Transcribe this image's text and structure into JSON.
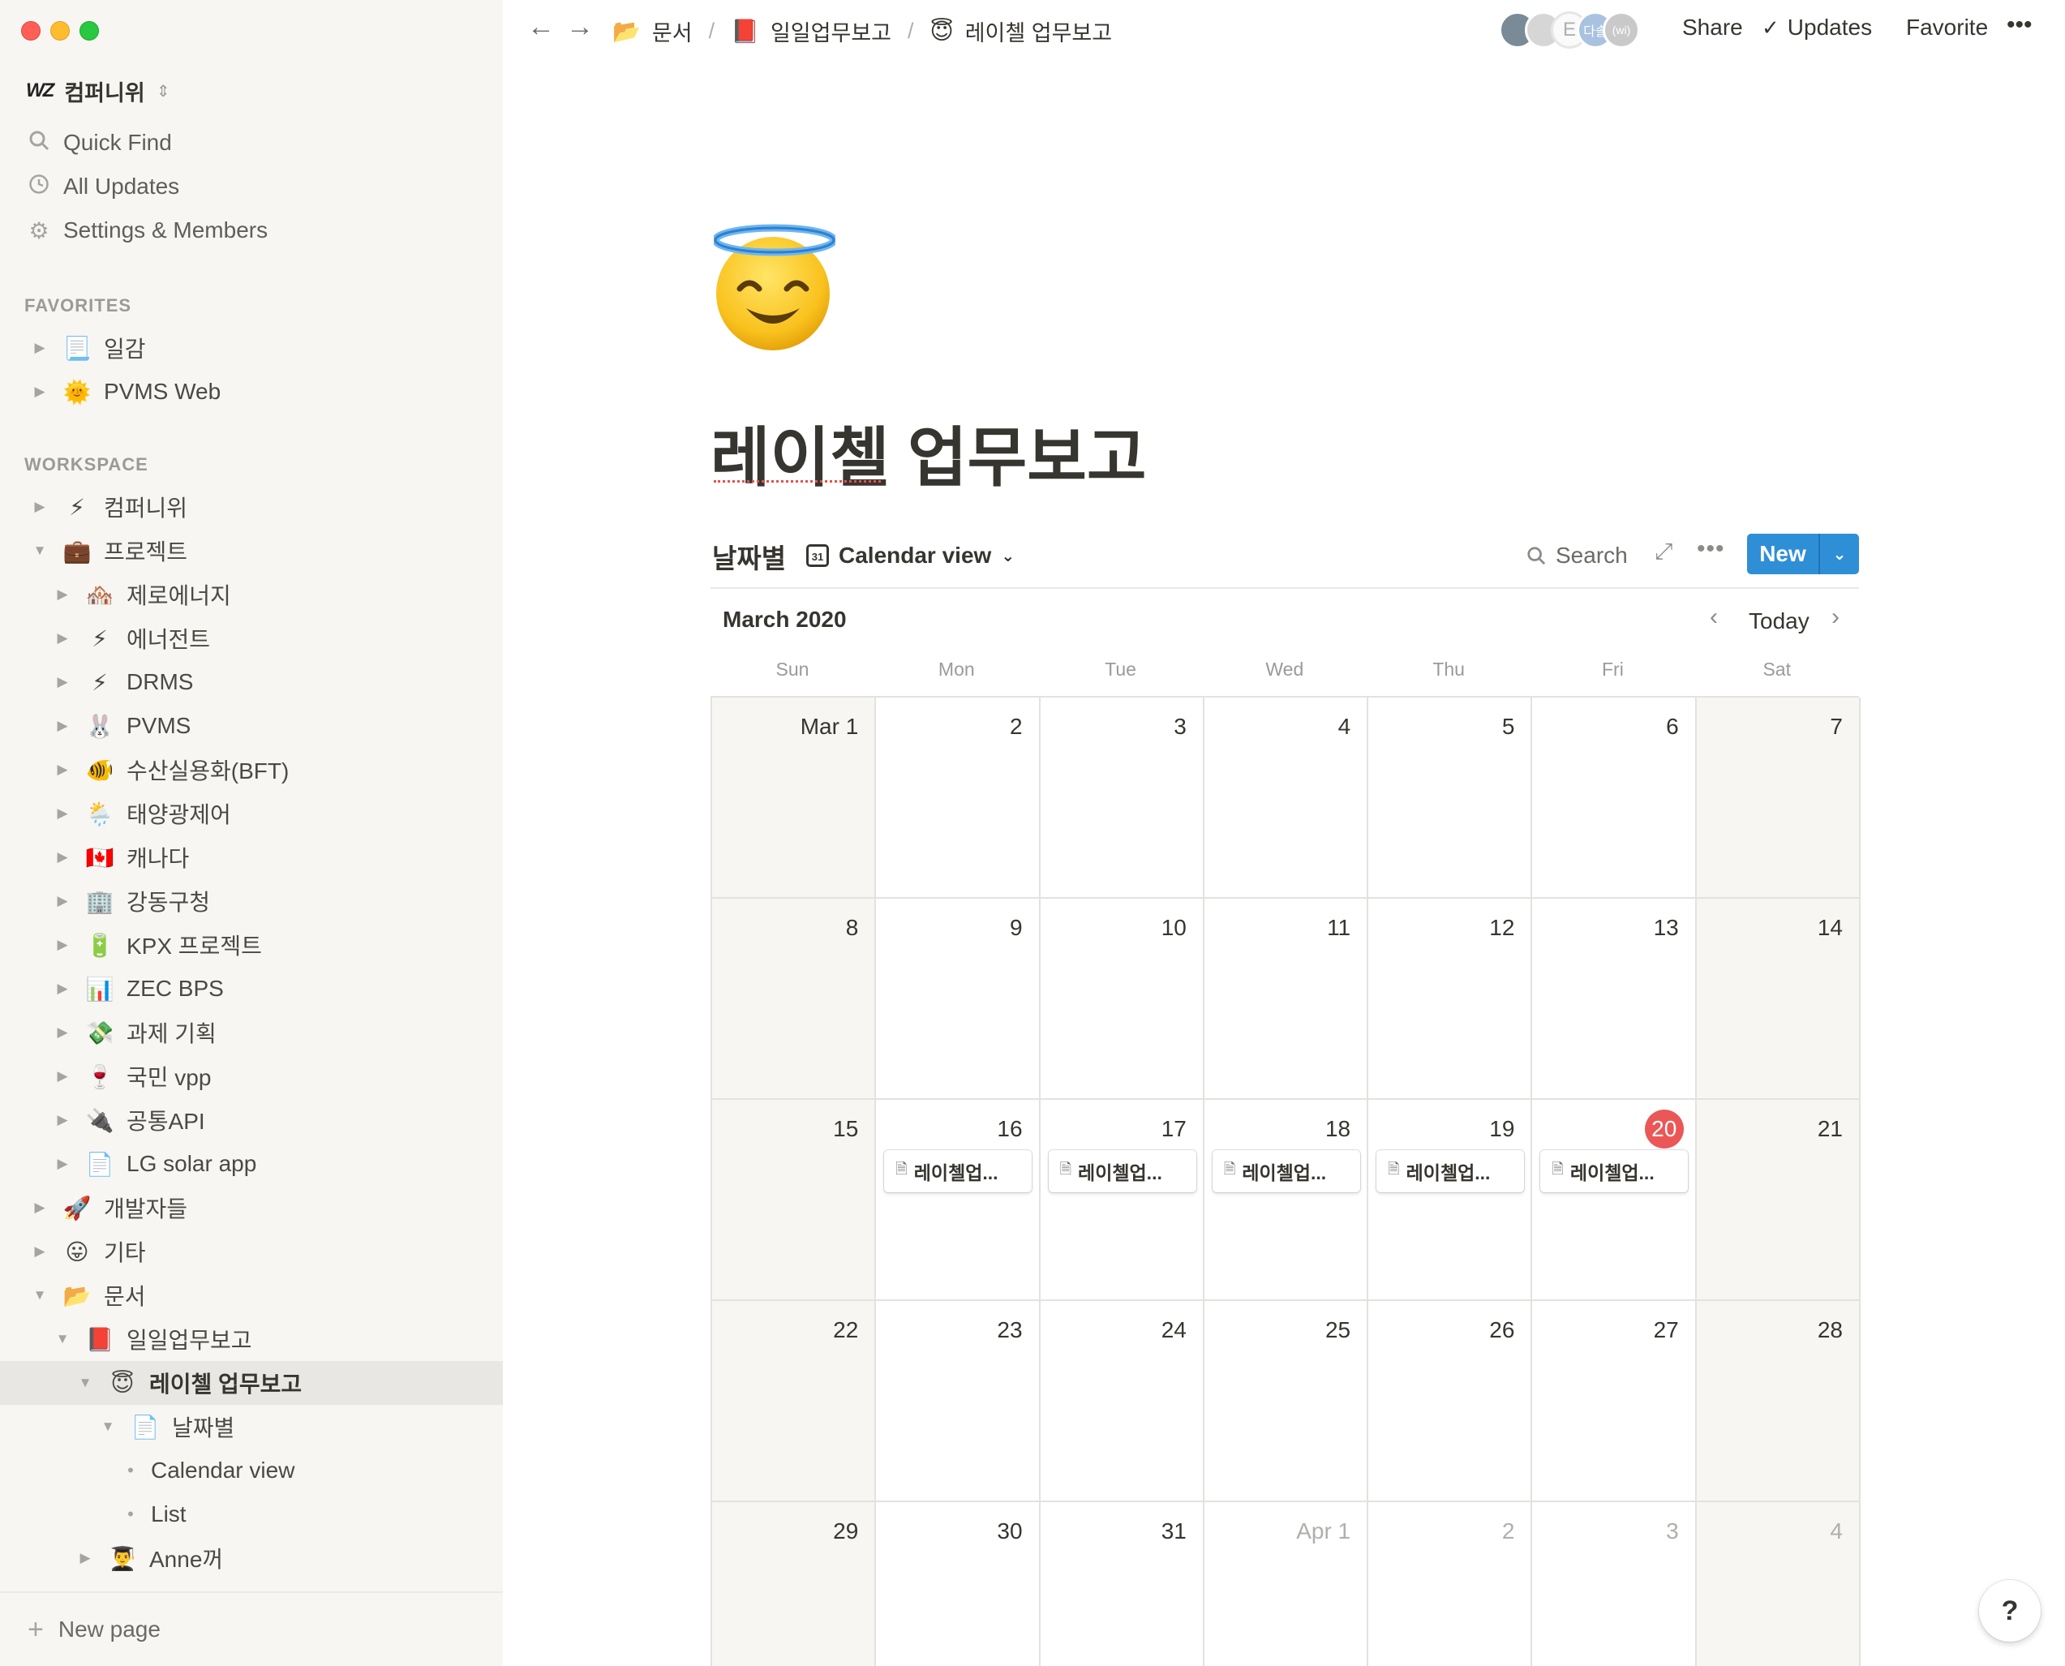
{
  "sidebar": {
    "workspace": {
      "logo": "WZ",
      "name": "컴퍼니위"
    },
    "menu": [
      {
        "label": "Quick Find",
        "icon": "search-icon"
      },
      {
        "label": "All Updates",
        "icon": "clock-icon"
      },
      {
        "label": "Settings & Members",
        "icon": "gear-icon"
      }
    ],
    "favorites_label": "FAVORITES",
    "favorites": [
      {
        "emoji": "📃",
        "label": "일감"
      },
      {
        "emoji": "🌞",
        "label": "PVMS Web"
      }
    ],
    "workspace_label": "WORKSPACE",
    "tree": [
      {
        "emoji": "⚡",
        "label": "컴퍼니위",
        "arrow": "▶"
      },
      {
        "emoji": "💼",
        "label": "프로젝트",
        "arrow": "▼"
      },
      {
        "emoji": "🏘️",
        "label": "제로에너지",
        "arrow": "▶"
      },
      {
        "emoji": "⚡",
        "label": "에너전트",
        "arrow": "▶"
      },
      {
        "emoji": "⚡",
        "label": "DRMS",
        "arrow": "▶"
      },
      {
        "emoji": "🐰",
        "label": "PVMS",
        "arrow": "▶"
      },
      {
        "emoji": "🐠",
        "label": "수산실용화(BFT)",
        "arrow": "▶"
      },
      {
        "emoji": "🌦️",
        "label": "태양광제어",
        "arrow": "▶"
      },
      {
        "emoji": "🇨🇦",
        "label": "캐나다",
        "arrow": "▶"
      },
      {
        "emoji": "🏢",
        "label": "강동구청",
        "arrow": "▶"
      },
      {
        "emoji": "🔋",
        "label": "KPX 프로젝트",
        "arrow": "▶"
      },
      {
        "emoji": "📊",
        "label": "ZEC BPS",
        "arrow": "▶"
      },
      {
        "emoji": "💸",
        "label": "과제 기획",
        "arrow": "▶"
      },
      {
        "emoji": "🍷",
        "label": "국민 vpp",
        "arrow": "▶"
      },
      {
        "emoji": "🔌",
        "label": "공통API",
        "arrow": "▶"
      },
      {
        "emoji": "📄",
        "label": "LG solar app",
        "arrow": "▶"
      },
      {
        "emoji": "🚀",
        "label": "개발자들",
        "arrow": "▶"
      },
      {
        "emoji": "😛",
        "label": "기타",
        "arrow": "▶"
      },
      {
        "emoji": "📂",
        "label": "문서",
        "arrow": "▼"
      },
      {
        "emoji": "📕",
        "label": "일일업무보고",
        "arrow": "▼"
      },
      {
        "emoji": "😇",
        "label": "레이첼 업무보고",
        "arrow": "▼"
      },
      {
        "emoji": "📄",
        "label": "날짜별",
        "arrow": "▼"
      },
      {
        "emoji": "",
        "label": "Calendar view",
        "arrow": "•"
      },
      {
        "emoji": "",
        "label": "List",
        "arrow": "•"
      },
      {
        "emoji": "👨‍🎓",
        "label": "Anne꺼",
        "arrow": "▶"
      }
    ],
    "new_page": "New page"
  },
  "topbar": {
    "breadcrumbs": [
      {
        "emoji": "📂",
        "label": "문서"
      },
      {
        "emoji": "📕",
        "label": "일일업무보고"
      },
      {
        "emoji": "😇",
        "label": "레이첼 업무보고"
      }
    ],
    "avatars": [
      "",
      "",
      "E",
      "다솔",
      "(wi)"
    ],
    "share": "Share",
    "updates": "Updates",
    "favorite": "Favorite",
    "more": "•••"
  },
  "page": {
    "title": "레이첼 업무보고",
    "icon": "smiling-face-with-halo-icon"
  },
  "database": {
    "name": "날짜별",
    "view_label": "Calendar view",
    "view_icon_text": "31",
    "search": "Search",
    "new_button": "New",
    "month": "March 2020",
    "today": "Today",
    "weekdays": [
      "Sun",
      "Mon",
      "Tue",
      "Wed",
      "Thu",
      "Fri",
      "Sat"
    ],
    "days": [
      "Mar 1",
      "2",
      "3",
      "4",
      "5",
      "6",
      "7",
      "8",
      "9",
      "10",
      "11",
      "12",
      "13",
      "14",
      "15",
      "16",
      "17",
      "18",
      "19",
      "20",
      "21",
      "22",
      "23",
      "24",
      "25",
      "26",
      "27",
      "28",
      "29",
      "30",
      "31",
      "Apr 1",
      "2",
      "3",
      "4"
    ],
    "today_day": "20",
    "card_label": "레이첼업...",
    "card_days": [
      "16",
      "17",
      "18",
      "19",
      "20"
    ]
  },
  "help": "?"
}
